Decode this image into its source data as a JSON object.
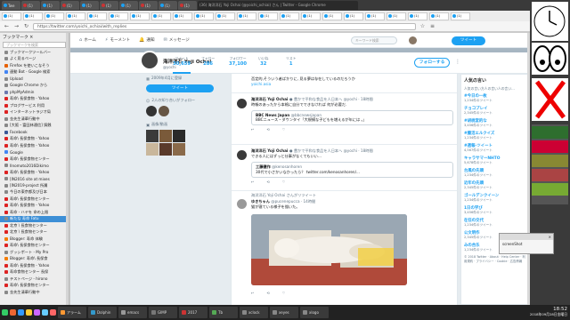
{
  "browser": {
    "window_title": "(36) 海洋洋石 Yoji Ochai (@yoichi_ochiai) さん | Twitter - Google Chrome",
    "tabs": [
      "Twe",
      "(1)",
      "(1)",
      "(1)",
      "(1)",
      "(1)",
      "(1)",
      "(1)",
      "(1)",
      "(1)"
    ],
    "sub_tabs": [
      "(1)",
      "(1)",
      "(1)",
      "(1)",
      "(1)",
      "(1)",
      "(1)",
      "(1)",
      "(1)",
      "(1)",
      "(1)",
      "(1)",
      "(1)",
      "(1)",
      "(1)",
      "(1)",
      "(1)",
      "(1)",
      "(1)",
      "(1)",
      "(1)",
      "(1)"
    ],
    "url": "https://twitter.com/yoichi_ochiai/with_replies"
  },
  "sidebar": {
    "title": "ブックマーク ×",
    "search_placeholder": "ブックマークを検索",
    "items": [
      {
        "label": "ブックマークツールバー",
        "color": "#888"
      },
      {
        "label": "よく見るページ",
        "color": "#888"
      },
      {
        "label": "Firefox を使いこなそう",
        "color": "#e66000"
      },
      {
        "label": "連動 Bot - Google 検索",
        "color": "#4285f4"
      },
      {
        "label": "Upload",
        "color": "#888"
      },
      {
        "label": "Google Chrome から",
        "color": "#888"
      },
      {
        "label": "phpMyAdmin",
        "color": "#6c78af"
      },
      {
        "label": "寿命\\ 長保食物 - Yahoo",
        "color": "#d22"
      },
      {
        "label": "プログサービス 利用",
        "color": "#d22"
      },
      {
        "label": "インターネットラジオ局",
        "color": "#d22"
      },
      {
        "label": "金先生清華行動中",
        "color": "#888"
      },
      {
        "label": "[大阪・富田林通信] 鋳銭",
        "color": "#888"
      },
      {
        "label": "Facebook",
        "color": "#3b5998"
      },
      {
        "label": "寿命\\ 長保食物 - Yahoo",
        "color": "#d22"
      },
      {
        "label": "寿命\\ 長保食物 - Yahoo",
        "color": "#d22"
      },
      {
        "label": "Google",
        "color": "#4285f4"
      },
      {
        "label": "寿命\\ 長保食物センター",
        "color": "#d22"
      },
      {
        "label": "IInomoto2016Dikimo",
        "color": "#888"
      },
      {
        "label": "寿命\\ 長保食物 - Yahoo",
        "color": "#d22"
      },
      {
        "label": "[IN2016 site at mixes",
        "color": "#888"
      },
      {
        "label": "[IN2019-project 所属",
        "color": "#888"
      },
      {
        "label": "今日の東京都及び日本",
        "color": "#888"
      },
      {
        "label": "寿命\\ 長保食物センター",
        "color": "#d22"
      },
      {
        "label": "寿命\\ 長保食物 - Yahoo",
        "color": "#d22"
      },
      {
        "label": "寿命 - ハヤを 命の上限",
        "color": "#d22"
      },
      {
        "label": "新たな 寿命 Fatu",
        "color": "#888"
      },
      {
        "label": "北京 \\ 長食物センター",
        "color": "#d22"
      },
      {
        "label": "北京 \\ 長食物センター",
        "color": "#d22"
      },
      {
        "label": "Blogger: 寿命 体験",
        "color": "#f57d00"
      },
      {
        "label": "寿命\\ 長保食物センター",
        "color": "#d22"
      },
      {
        "label": "グッシポート - My Pro",
        "color": "#888"
      },
      {
        "label": "Blogger: 寿命\\ 長保食",
        "color": "#f57d00"
      },
      {
        "label": "寿命\\ 長保食物 - Yahoo",
        "color": "#d22"
      },
      {
        "label": "寿命食物センター 長保",
        "color": "#d22"
      },
      {
        "label": "テストページ - hirono",
        "color": "#888"
      },
      {
        "label": "寿命\\ 長保食物センター",
        "color": "#d22"
      },
      {
        "label": "金先生清華行動中",
        "color": "#888"
      }
    ],
    "selected_index": 25
  },
  "twitter": {
    "nav": [
      {
        "icon": "home-icon",
        "glyph": "⌂",
        "label": "ホーム"
      },
      {
        "icon": "moments-icon",
        "glyph": "⚡",
        "label": "モーメント"
      },
      {
        "icon": "notifications-icon",
        "glyph": "🔔",
        "label": "通知"
      },
      {
        "icon": "messages-icon",
        "glyph": "✉",
        "label": "メッセージ"
      }
    ],
    "search_placeholder": "キーワード検索",
    "tweet_button": "ツイート",
    "profile": {
      "name": "海洋洋石 Yoji Ochai",
      "handle": "@yochi",
      "follow_button": "フォローする",
      "more": "⋮",
      "stats": [
        {
          "label": "ツイート",
          "value": "30,659"
        },
        {
          "label": "フォロー",
          "value": "286"
        },
        {
          "label": "フォロワー",
          "value": "37,100"
        },
        {
          "label": "いいね",
          "value": "32"
        },
        {
          "label": "リスト",
          "value": "1"
        }
      ]
    },
    "left": {
      "joined": "2009年4月に登録",
      "tweet_button": "ツイート",
      "followers_you_know": "2人の知り合いがフォロー",
      "photos_header": "画像/動画",
      "photo_colors": [
        "#3a3a3a",
        "#7a5a3a",
        "#2a2a2a",
        "#c9b79c",
        "#5a3a2a",
        "#8a6a4a"
      ]
    },
    "tweets": [
      {
        "name": "",
        "handle": "",
        "text": "否定的,そういう者ばかりに, 見る夢は存在しているのだろうか",
        "link": "yoichi.asia",
        "actions": [
          "↩",
          "⟲",
          "♡"
        ]
      },
      {
        "name": "海洋洋石 Yoji Ochai",
        "handle": "● 豊かで平和な食品を人日本へ @yochi · 18時間",
        "text": "時報のあったから本格に自分でできなければ 何が必要だ.",
        "quote_name": "BBC News Japan",
        "quote_handle": "@bbcnewsjapan",
        "quote_text": "BBCニュース・ダウンタイ「大規模な子どもを増えるが年には 。」",
        "actions": [
          "↩",
          "⟲",
          "♡"
        ]
      },
      {
        "name": "海洋洋石 Yoji Ochai",
        "handle": "● 豊かで平和な食品を人日本へ @yochi · 18時間",
        "text": "できる人にはずっと仕事がなくてもいい…",
        "quote_name": "工藤健作",
        "quote_handle": "@kenosanhoren",
        "quote_text": "30代で小さかいなかったら？ twitter.com/kenosanhoren/...",
        "actions": [
          "↩",
          "⟲",
          "♡"
        ]
      },
      {
        "retweet": "海洋洋石 Yoji Ochai さんがリツイート",
        "name": "ゆきちゃん",
        "handle": "@pucenepucca · 14時間",
        "text": "猫が寝ている様子を描いた。",
        "actions": [
          "↩",
          "⟲",
          "♡"
        ]
      }
    ],
    "trends": {
      "header": "人気の言い",
      "intro": "人気の言い方人の言い人の言い... ",
      "items": [
        {
          "name": "#今日の一枚",
          "sub": "1,234件のツイート"
        },
        {
          "name": "チョコプレイ",
          "sub": "2,345件のツイート"
        },
        {
          "name": "#胡桃堂的な",
          "sub": "3,456件のツイート"
        },
        {
          "name": "#腸活エルクイズ",
          "sub": "1,234件のツイート"
        },
        {
          "name": "#週報-ツイート",
          "sub": "4,567件のツイート"
        },
        {
          "name": "キャラサマーNHTO",
          "sub": "5,678件のツイート"
        },
        {
          "name": "台風の先頭",
          "sub": "1,234件のツイート"
        },
        {
          "name": "近年の先頭",
          "sub": "2,345件のツイート"
        },
        {
          "name": "ゴールデンクイーン",
          "sub": "1,234件のツイート"
        },
        {
          "name": "1日の学び",
          "sub": "3,456件のツイート"
        },
        {
          "name": "在任の交代",
          "sub": "1,234件のツイート"
        },
        {
          "name": "公文明作",
          "sub": "2,345件のツイート"
        },
        {
          "name": "みの合乐",
          "sub": "1,234件のツイート"
        }
      ],
      "footer": "© 2018 Twitter · About · Help Center · 利用規約 · プライバシー · Cookie · 広告情報"
    }
  },
  "taskbar": {
    "items": [
      "アラーム",
      "Dolphin",
      "emacs",
      "GIMP",
      "2017",
      "Tb",
      "xclock",
      "xeyes",
      "xlogo"
    ],
    "tray_time": "18:52",
    "tray_date": "2018年09月28日金曜日"
  },
  "popup": {
    "title": "×",
    "text": "screenShot"
  }
}
